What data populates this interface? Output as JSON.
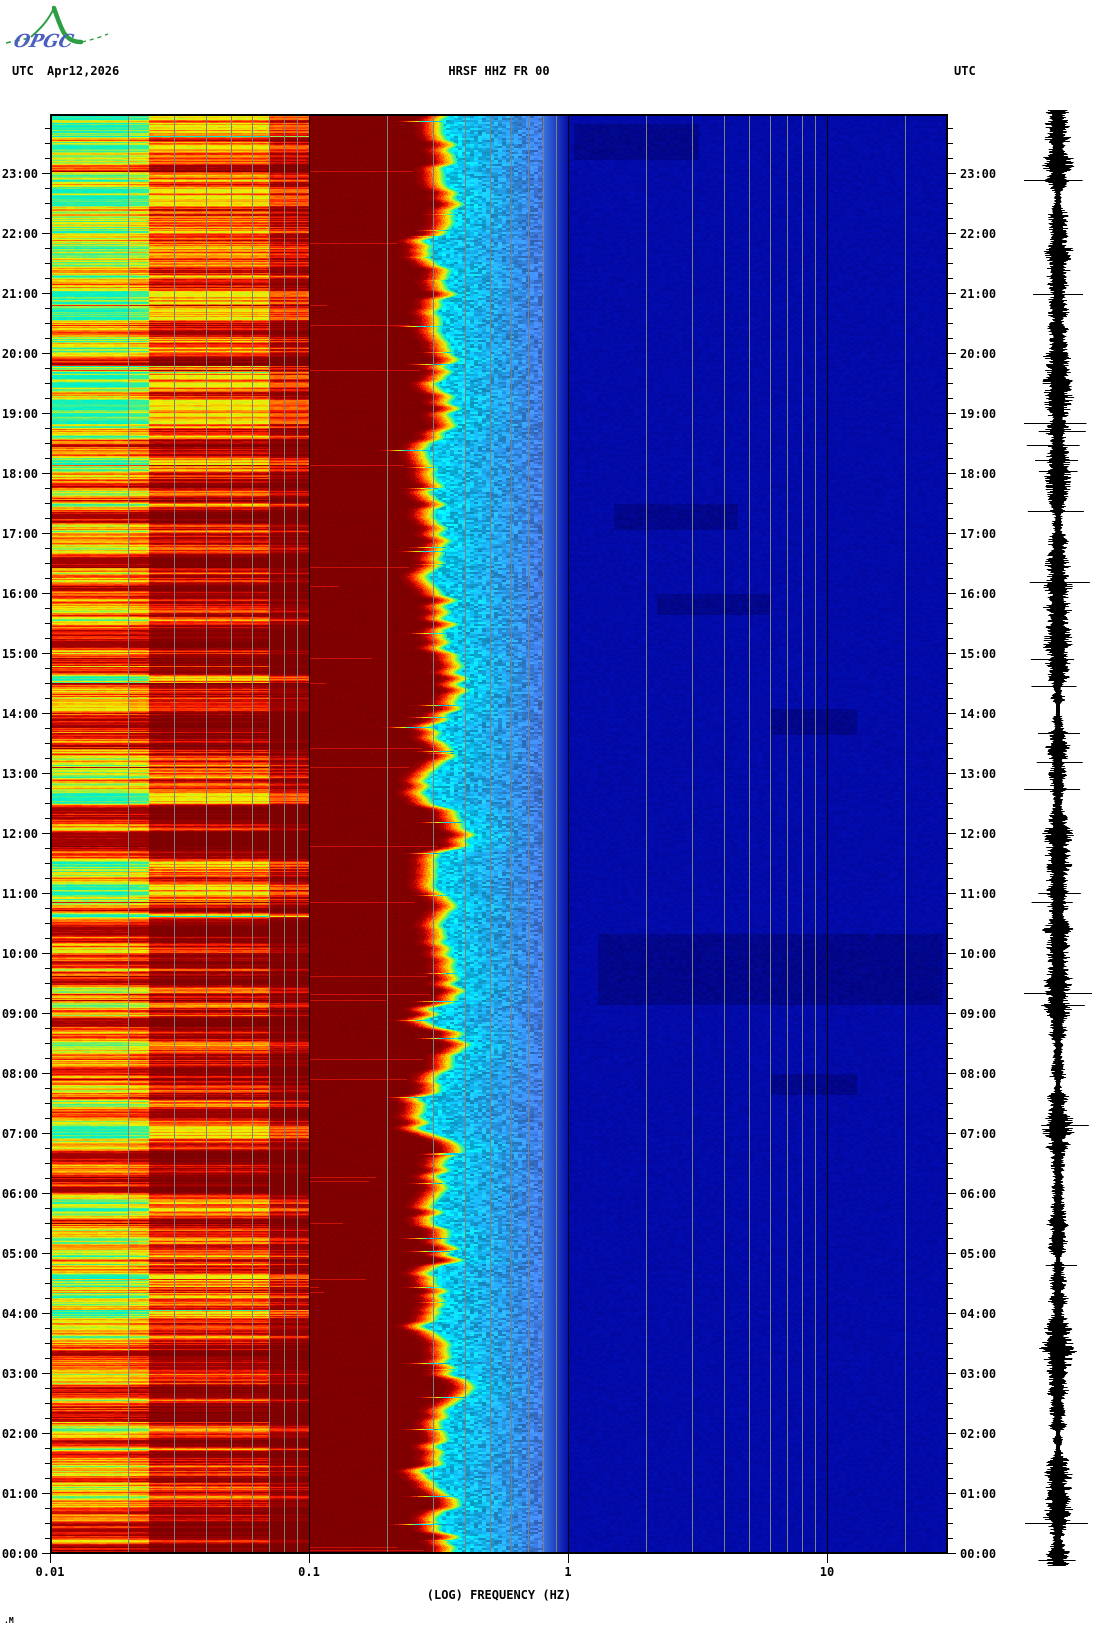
{
  "header": {
    "logo_text": "OPGC",
    "utc_left": "UTC",
    "date": "Apr12,2026",
    "title": "HRSF HHZ FR 00",
    "utc_right": "UTC"
  },
  "footer_mark": ".M",
  "chart_data": {
    "type": "heatmap",
    "subtype": "seismic-spectrogram-day-plot",
    "title": "HRSF HHZ FR 00",
    "xlabel": "(LOG) FREQUENCY (HZ)",
    "x_scale": "log",
    "x_ticks": [
      {
        "label": "0.01",
        "hz": 0.01
      },
      {
        "label": "0.1",
        "hz": 0.1
      },
      {
        "label": "1",
        "hz": 1
      },
      {
        "label": "10",
        "hz": 10
      }
    ],
    "x_range_hz": [
      0.01,
      29.0
    ],
    "y_axis_unit": "UTC time of day, 00:00 at bottom to 24:00 at top",
    "hour_labels": [
      "00:00",
      "01:00",
      "02:00",
      "03:00",
      "04:00",
      "05:00",
      "06:00",
      "07:00",
      "08:00",
      "09:00",
      "10:00",
      "11:00",
      "12:00",
      "13:00",
      "14:00",
      "15:00",
      "16:00",
      "17:00",
      "18:00",
      "19:00",
      "20:00",
      "21:00",
      "22:00",
      "23:00"
    ],
    "minor_tick_minutes": 15,
    "grid": true,
    "colors": {
      "background": "#ffffff",
      "grid_minor": "#808080",
      "grid_decade": "#000000",
      "maroon_band": "#7f0000",
      "deep_blue": "#000aa8",
      "cyan_band": "#00cdf0",
      "trace": "#000000",
      "text": "#000000",
      "logo_green": "#2e9e44",
      "logo_blue": "#4a5fc0"
    },
    "bands": [
      {
        "hz": [
          0.01,
          0.024
        ],
        "style": "striped",
        "palette_offset": 0.0
      },
      {
        "hz": [
          0.024,
          0.07
        ],
        "style": "striped",
        "palette_offset": 0.27
      },
      {
        "hz": [
          0.07,
          0.1
        ],
        "style": "striped",
        "palette_offset": 0.47
      },
      {
        "hz": [
          0.1,
          0.3
        ],
        "style": "solid-maroon"
      },
      {
        "hz": [
          0.3,
          0.42
        ],
        "style": "jagged-warm-transition"
      },
      {
        "hz": [
          0.42,
          0.8
        ],
        "style": "cyan-to-blue-mottle"
      },
      {
        "hz": [
          0.8,
          29.0
        ],
        "style": "deep-blue"
      }
    ],
    "time_palette_drift": [
      {
        "hours": [
          19,
          24
        ],
        "tone": "cyan-green"
      },
      {
        "hours": [
          10,
          19
        ],
        "tone": "yellow-orange"
      },
      {
        "hours": [
          0,
          10
        ],
        "tone": "orange-red"
      }
    ],
    "dark_patches": [
      {
        "time": "09:10-10:20",
        "hz": [
          1.3,
          28
        ]
      },
      {
        "time": "23:15-23:50",
        "hz": [
          1.05,
          3.2
        ]
      },
      {
        "time": "17:05-17:30",
        "hz": [
          1.5,
          4.5
        ]
      },
      {
        "time": "15:40-16:00",
        "hz": [
          2.2,
          6.0
        ]
      },
      {
        "time": "13:40-14:05",
        "hz": [
          6.0,
          13.0
        ]
      },
      {
        "time": "07:40-08:00",
        "hz": [
          6.0,
          13.0
        ]
      }
    ],
    "trace_panel": {
      "present": true,
      "description": "vertical seismogram amplitude trace",
      "color": "#000000"
    }
  }
}
